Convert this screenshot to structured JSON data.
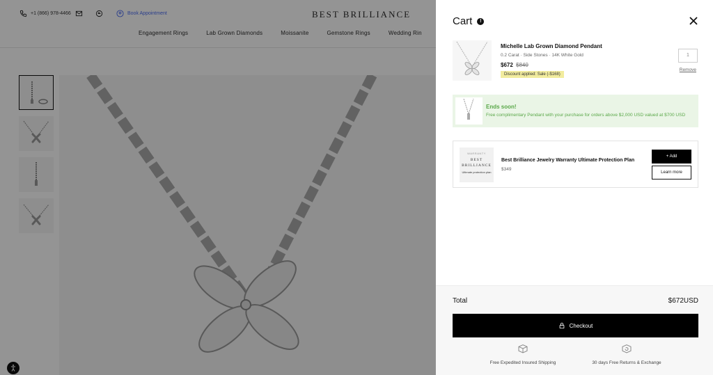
{
  "topbar": {
    "phone": "+1 (866) 978-4466",
    "book": "Book Appointment",
    "brand": "BEST BRILLIANCE"
  },
  "nav": {
    "items": [
      "Engagement Rings",
      "Lab Grown Diamonds",
      "Moissanite",
      "Gemstone Rings",
      "Wedding Rin"
    ]
  },
  "cart": {
    "title": "Cart",
    "item": {
      "name": "Michelle Lab Grown Diamond Pendant",
      "details": "0.2 Carat · Side Stones · 14K White Gold",
      "price": "$672",
      "old_price": "$840",
      "discount": "Discount applied:  Sale (-$168)",
      "quantity": "1",
      "remove": "Remove"
    },
    "promo": {
      "title": "Ends soon!",
      "text": "Free complimentary Pendant with your purchase for orders above $2,000 USD valued at $700 USD"
    },
    "warranty": {
      "logo_top": "WARRANTY",
      "logo_brand": "BEST BRILLIANCE",
      "logo_sub": "Ultimate protection plan",
      "title": "Best Brilliance Jewelry Warranty Ultimate Protection Plan",
      "price": "$349",
      "add": "+ Add",
      "learn": "Learn more"
    },
    "total_label": "Total",
    "total_value": "$672USD",
    "checkout": "Checkout",
    "perks": [
      "Free Expedited Insured Shipping",
      "30 days Free Returns & Exchange"
    ]
  },
  "colors": {
    "promo_green": "#5aa849",
    "promo_bg": "#eaf5e6",
    "discount_bg": "#f2ec9e",
    "checkout_bg": "#000000"
  }
}
